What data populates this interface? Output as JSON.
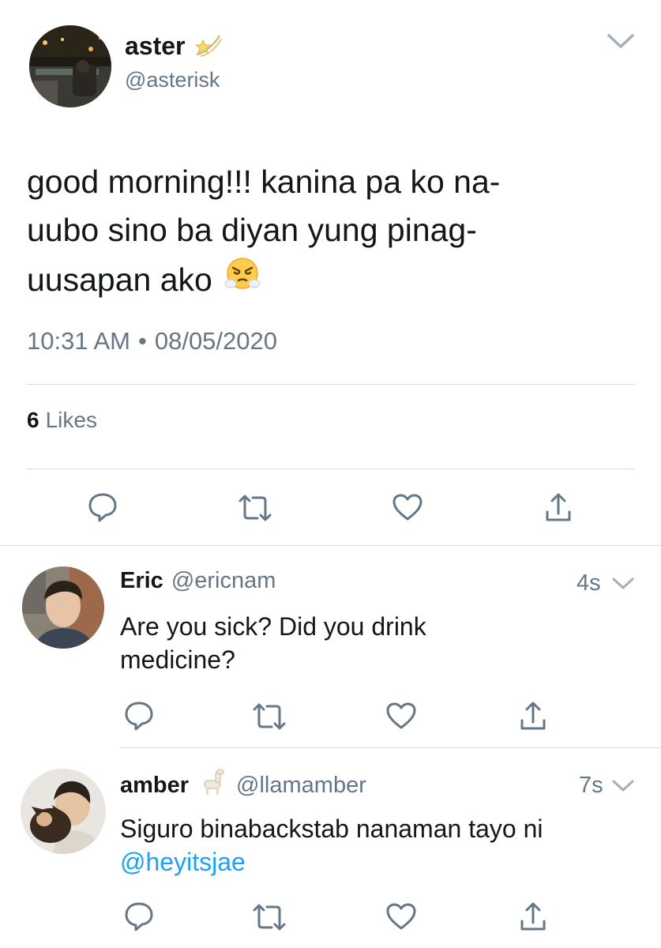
{
  "colors": {
    "accent": "#1da1f2",
    "muted": "#657786",
    "text": "#14171a",
    "icon": "#657786",
    "divider": "#d7dbdf"
  },
  "main_tweet": {
    "name": "aster",
    "name_emoji": "dizzy-icon",
    "handle": "@asterisk",
    "text_lines": [
      "good morning!!! kanina pa ko na-",
      "uubo sino ba diyan yung pinag-",
      "uusapan ako"
    ],
    "text_emoji": "face-with-steam-from-nose",
    "time": "10:31 AM",
    "separator": "•",
    "date": "08/05/2020",
    "likes_count": "6",
    "likes_label": "Likes",
    "actions": [
      "reply-icon",
      "retweet-icon",
      "like-icon",
      "share-icon"
    ]
  },
  "replies": [
    {
      "name": "Eric",
      "handle": "@ericnam",
      "time": "4s",
      "text_lines": [
        "Are you sick? Did you drink",
        "medicine?"
      ]
    },
    {
      "name": "amber",
      "name_emoji": "llama-icon",
      "handle": "@llamamber",
      "time": "7s",
      "text_line1": "Siguro binabackstab nanaman tayo ni",
      "mention": "@heyitsjae"
    }
  ]
}
